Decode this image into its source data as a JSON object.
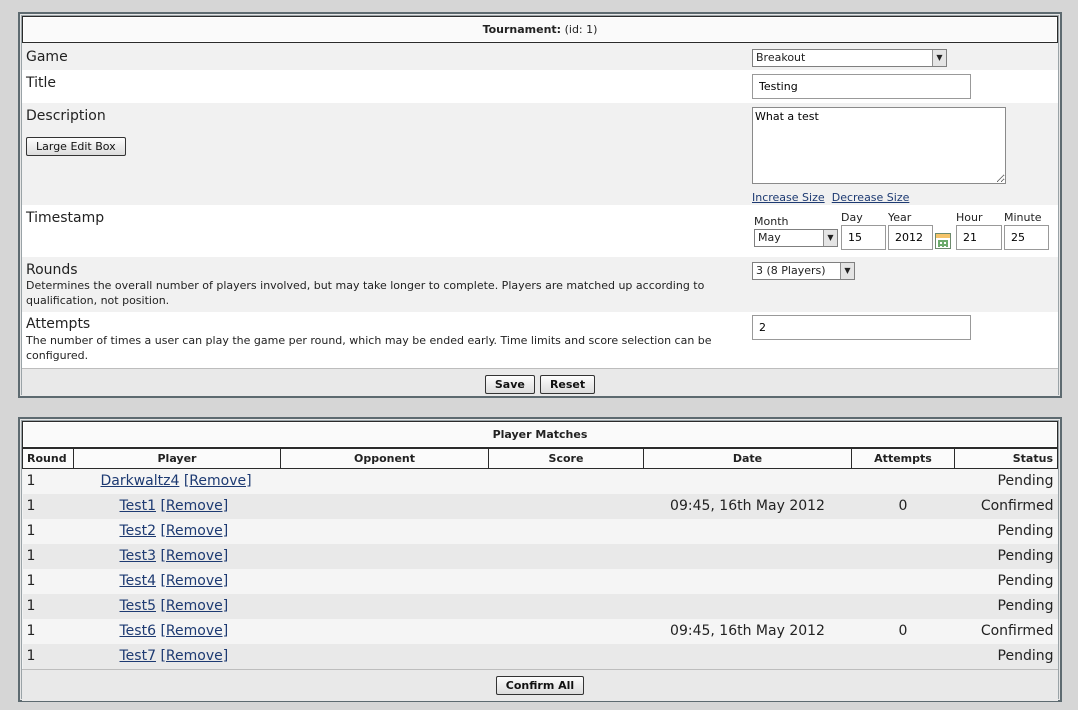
{
  "tournament": {
    "heading_label": "Tournament:",
    "heading_id": "(id: 1)",
    "game": {
      "label": "Game",
      "value": "Breakout"
    },
    "title": {
      "label": "Title",
      "value": "Testing"
    },
    "description": {
      "label": "Description",
      "large_edit_button": "Large Edit Box",
      "value": "What a test",
      "increase_link": "Increase Size",
      "decrease_link": "Decrease Size"
    },
    "timestamp": {
      "label": "Timestamp",
      "month_label": "Month",
      "month_value": "May",
      "day_label": "Day",
      "day_value": "15",
      "year_label": "Year",
      "year_value": "2012",
      "hour_label": "Hour",
      "hour_value": "21",
      "minute_label": "Minute",
      "minute_value": "25"
    },
    "rounds": {
      "label": "Rounds",
      "help": "Determines the overall number of players involved, but may take longer to complete. Players are matched up according to qualification, not position.",
      "value": "3 (8 Players)"
    },
    "attempts": {
      "label": "Attempts",
      "help": "The number of times a user can play the game per round, which may be ended early. Time limits and score selection can be configured.",
      "value": "2"
    },
    "save_button": "Save",
    "reset_button": "Reset"
  },
  "matches": {
    "heading": "Player Matches",
    "columns": [
      "Round",
      "Player",
      "Opponent",
      "Score",
      "Date",
      "Attempts",
      "Status"
    ],
    "remove_label": "[Remove]",
    "rows": [
      {
        "round": "1",
        "player": "Darkwaltz4",
        "opponent": "",
        "score": "",
        "date": "",
        "attempts": "",
        "status": "Pending"
      },
      {
        "round": "1",
        "player": "Test1",
        "opponent": "",
        "score": "",
        "date": "09:45, 16th May 2012",
        "attempts": "0",
        "status": "Confirmed"
      },
      {
        "round": "1",
        "player": "Test2",
        "opponent": "",
        "score": "",
        "date": "",
        "attempts": "",
        "status": "Pending"
      },
      {
        "round": "1",
        "player": "Test3",
        "opponent": "",
        "score": "",
        "date": "",
        "attempts": "",
        "status": "Pending"
      },
      {
        "round": "1",
        "player": "Test4",
        "opponent": "",
        "score": "",
        "date": "",
        "attempts": "",
        "status": "Pending"
      },
      {
        "round": "1",
        "player": "Test5",
        "opponent": "",
        "score": "",
        "date": "",
        "attempts": "",
        "status": "Pending"
      },
      {
        "round": "1",
        "player": "Test6",
        "opponent": "",
        "score": "",
        "date": "09:45, 16th May 2012",
        "attempts": "0",
        "status": "Confirmed"
      },
      {
        "round": "1",
        "player": "Test7",
        "opponent": "",
        "score": "",
        "date": "",
        "attempts": "",
        "status": "Pending"
      }
    ],
    "confirm_all_button": "Confirm All"
  },
  "icons": {
    "calendar": "calendar-icon",
    "dropdown": "chevron-down-icon"
  }
}
